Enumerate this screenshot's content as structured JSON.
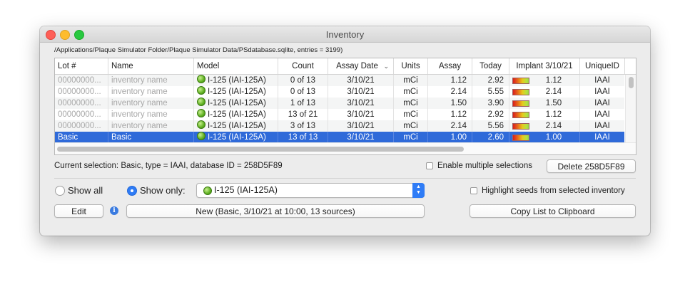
{
  "window": {
    "title": "Inventory"
  },
  "db_path": "/Applications/Plaque Simulator Folder/Plaque Simulator Data/PSdatabase.sqlite, entries = 3199)",
  "table": {
    "columns": [
      "Lot #",
      "Name",
      "Model",
      "Count",
      "Assay Date",
      "Units",
      "Assay",
      "Today",
      "Implant 3/10/21",
      "UniqueID"
    ],
    "rows": [
      {
        "lot": "00000000...",
        "name": "inventory name",
        "model": "I-125 (IAI-125A)",
        "count": "0 of 13",
        "assay_date": "3/10/21",
        "units": "mCi",
        "assay": "1.12",
        "today": "2.92",
        "implant": "1.12",
        "unique_id": "IAAI"
      },
      {
        "lot": "00000000...",
        "name": "inventory name",
        "model": "I-125 (IAI-125A)",
        "count": "0 of 13",
        "assay_date": "3/10/21",
        "units": "mCi",
        "assay": "2.14",
        "today": "5.55",
        "implant": "2.14",
        "unique_id": "IAAI"
      },
      {
        "lot": "00000000...",
        "name": "inventory name",
        "model": "I-125 (IAI-125A)",
        "count": "1 of 13",
        "assay_date": "3/10/21",
        "units": "mCi",
        "assay": "1.50",
        "today": "3.90",
        "implant": "1.50",
        "unique_id": "IAAI"
      },
      {
        "lot": "00000000...",
        "name": "inventory name",
        "model": "I-125 (IAI-125A)",
        "count": "13 of 21",
        "assay_date": "3/10/21",
        "units": "mCi",
        "assay": "1.12",
        "today": "2.92",
        "implant": "1.12",
        "unique_id": "IAAI"
      },
      {
        "lot": "00000000...",
        "name": "inventory name",
        "model": "I-125 (IAI-125A)",
        "count": "3 of 13",
        "assay_date": "3/10/21",
        "units": "mCi",
        "assay": "2.14",
        "today": "5.56",
        "implant": "2.14",
        "unique_id": "IAAI"
      },
      {
        "lot": "Basic",
        "name": "Basic",
        "model": "I-125 (IAI-125A)",
        "count": "13 of 13",
        "assay_date": "3/10/21",
        "units": "mCi",
        "assay": "1.00",
        "today": "2.60",
        "implant": "1.00",
        "unique_id": "IAAI",
        "selected": true
      }
    ]
  },
  "status": {
    "current_selection": "Current selection: Basic, type = IAAI, database ID = 258D5F89",
    "enable_multiple_label": "Enable multiple selections",
    "delete_label": "Delete 258D5F89"
  },
  "filter": {
    "show_all_label": "Show all",
    "show_only_label": "Show only:",
    "selected_model": "I-125 (IAI-125A)",
    "highlight_label": "Highlight seeds from selected inventory"
  },
  "actions": {
    "edit_label": "Edit",
    "new_label": "New (Basic, 3/10/21 at 10:00, 13 sources)",
    "copy_label": "Copy List to Clipboard"
  },
  "colors": {
    "selection": "#2f6ad9",
    "accent": "#2f7cf6"
  },
  "icons": [
    "close-icon",
    "minimize-icon",
    "zoom-icon",
    "seed-model-icon",
    "implant-gradient-icon",
    "info-icon",
    "sort-chevron-icon",
    "stepper-icon"
  ]
}
